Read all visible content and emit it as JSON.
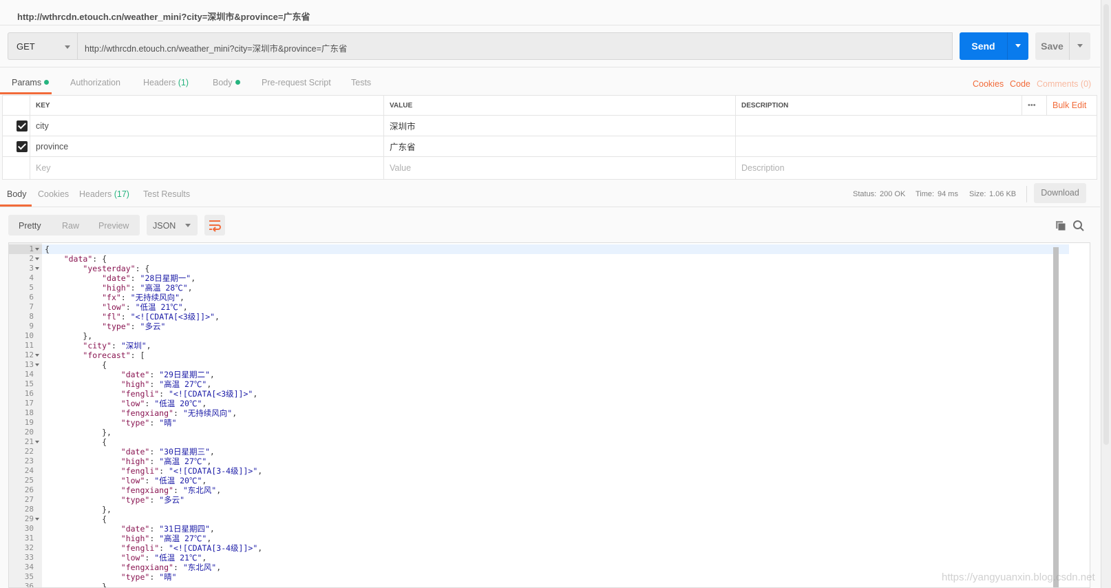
{
  "title": "http://wthrcdn.etouch.cn/weather_mini?city=深圳市&province=广东省",
  "request": {
    "method": "GET",
    "url": "http://wthrcdn.etouch.cn/weather_mini?city=深圳市&province=广东省",
    "send_label": "Send",
    "save_label": "Save"
  },
  "request_tabs": [
    {
      "label": "Params",
      "dot": true
    },
    {
      "label": "Authorization"
    },
    {
      "label": "Headers",
      "count": "(1)"
    },
    {
      "label": "Body",
      "dot": true
    },
    {
      "label": "Pre-request Script"
    },
    {
      "label": "Tests"
    }
  ],
  "right_links": {
    "cookies": "Cookies",
    "code": "Code",
    "comments": "Comments (0)"
  },
  "params": {
    "headers": [
      "KEY",
      "VALUE",
      "DESCRIPTION"
    ],
    "more": "•••",
    "bulk_edit": "Bulk Edit",
    "rows": [
      {
        "checked": true,
        "key": "city",
        "value": "深圳市",
        "description": ""
      },
      {
        "checked": true,
        "key": "province",
        "value": "广东省",
        "description": ""
      }
    ],
    "placeholders": {
      "key": "Key",
      "value": "Value",
      "description": "Description"
    }
  },
  "response_tabs": [
    {
      "label": "Body"
    },
    {
      "label": "Cookies"
    },
    {
      "label": "Headers",
      "count": "(17)"
    },
    {
      "label": "Test Results"
    }
  ],
  "status": {
    "status_label": "Status:",
    "status_value": "200 OK",
    "time_label": "Time:",
    "time_value": "94 ms",
    "size_label": "Size:",
    "size_value": "1.06 KB",
    "download": "Download"
  },
  "view_modes": [
    "Pretty",
    "Raw",
    "Preview"
  ],
  "format": "JSON",
  "colors": {
    "accent": "#f26b3a",
    "send": "#097bed",
    "success": "#26b47f",
    "json_key": "#881350",
    "json_string": "#1a1aa6"
  },
  "editor": {
    "fold_lines": [
      1,
      2,
      3,
      12,
      13,
      21,
      29
    ],
    "lines": [
      "{",
      "    \"data\": {",
      "        \"yesterday\": {",
      "            \"date\": \"28日星期一\",",
      "            \"high\": \"高温 28℃\",",
      "            \"fx\": \"无持续风向\",",
      "            \"low\": \"低温 21℃\",",
      "            \"fl\": \"<![CDATA[<3级]]>\",",
      "            \"type\": \"多云\"",
      "        },",
      "        \"city\": \"深圳\",",
      "        \"forecast\": [",
      "            {",
      "                \"date\": \"29日星期二\",",
      "                \"high\": \"高温 27℃\",",
      "                \"fengli\": \"<![CDATA[<3级]]>\",",
      "                \"low\": \"低温 20℃\",",
      "                \"fengxiang\": \"无持续风向\",",
      "                \"type\": \"晴\"",
      "            },",
      "            {",
      "                \"date\": \"30日星期三\",",
      "                \"high\": \"高温 27℃\",",
      "                \"fengli\": \"<![CDATA[3-4级]]>\",",
      "                \"low\": \"低温 20℃\",",
      "                \"fengxiang\": \"东北风\",",
      "                \"type\": \"多云\"",
      "            },",
      "            {",
      "                \"date\": \"31日星期四\",",
      "                \"high\": \"高温 27℃\",",
      "                \"fengli\": \"<![CDATA[3-4级]]>\",",
      "                \"low\": \"低温 21℃\",",
      "                \"fengxiang\": \"东北风\",",
      "                \"type\": \"晴\"",
      "            },"
    ]
  },
  "watermark": "https://yangyuanxin.blog.csdn.net"
}
